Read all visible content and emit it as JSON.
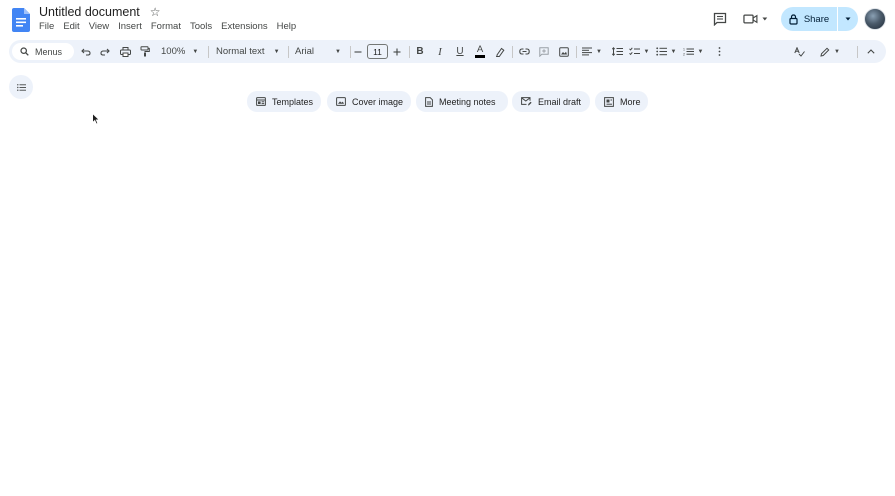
{
  "header": {
    "title": "Untitled document",
    "menus": [
      "File",
      "Edit",
      "View",
      "Insert",
      "Format",
      "Tools",
      "Extensions",
      "Help"
    ],
    "share_label": "Share"
  },
  "toolbar": {
    "search_label": "Menus",
    "zoom": "100%",
    "style": "Normal text",
    "font": "Arial",
    "font_size": "11"
  },
  "chips": [
    {
      "label": "Templates",
      "icon": "templates-icon"
    },
    {
      "label": "Cover image",
      "icon": "image-icon"
    },
    {
      "label": "Meeting notes",
      "icon": "document-icon"
    },
    {
      "label": "Email draft",
      "icon": "email-draft-icon"
    },
    {
      "label": "More",
      "icon": "more-icon"
    }
  ],
  "colors": {
    "docs_blue": "#4285f4",
    "share_bg": "#c2e7ff",
    "toolbar_bg": "#edf2fa",
    "text_color_bar": "#000000"
  }
}
